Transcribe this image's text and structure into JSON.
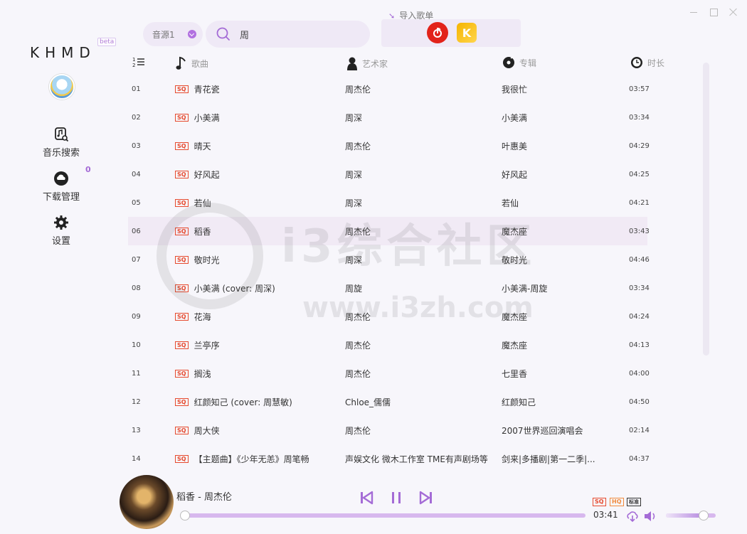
{
  "app": {
    "logo": "KHMD",
    "beta_tag": "beta"
  },
  "sidebar": {
    "items": [
      {
        "label": "音乐搜索",
        "icon": "music-search-icon"
      },
      {
        "label": "下载管理",
        "icon": "cloud-download-icon",
        "badge": "0"
      },
      {
        "label": "设置",
        "icon": "gear-icon"
      }
    ]
  },
  "topbar": {
    "source": "音源1",
    "search_value": "周",
    "import_label": "导入歌单"
  },
  "table": {
    "headers": {
      "title": "歌曲",
      "artist": "艺术家",
      "album": "专辑",
      "duration": "时长"
    },
    "rows": [
      {
        "num": "01",
        "title": "青花瓷",
        "artist": "周杰伦",
        "album": "我很忙",
        "duration": "03:57"
      },
      {
        "num": "02",
        "title": "小美满",
        "artist": "周深",
        "album": "小美满",
        "duration": "03:34"
      },
      {
        "num": "03",
        "title": "晴天",
        "artist": "周杰伦",
        "album": "叶惠美",
        "duration": "04:29"
      },
      {
        "num": "04",
        "title": "好风起",
        "artist": "周深",
        "album": "好风起",
        "duration": "04:25"
      },
      {
        "num": "05",
        "title": "若仙",
        "artist": "周深",
        "album": "若仙",
        "duration": "04:21"
      },
      {
        "num": "06",
        "title": "稻香",
        "artist": "周杰伦",
        "album": "魔杰座",
        "duration": "03:43"
      },
      {
        "num": "07",
        "title": "敬时光",
        "artist": "周深",
        "album": "敬时光",
        "duration": "04:46"
      },
      {
        "num": "08",
        "title": "小美满 (cover: 周深)",
        "artist": "周旋",
        "album": "小美满-周旋",
        "duration": "03:34"
      },
      {
        "num": "09",
        "title": "花海",
        "artist": "周杰伦",
        "album": "魔杰座",
        "duration": "04:24"
      },
      {
        "num": "10",
        "title": "兰亭序",
        "artist": "周杰伦",
        "album": "魔杰座",
        "duration": "04:13"
      },
      {
        "num": "11",
        "title": "搁浅",
        "artist": "周杰伦",
        "album": "七里香",
        "duration": "04:00"
      },
      {
        "num": "12",
        "title": "红颜知己 (cover: 周慧敏)",
        "artist": "Chloe_儒儒",
        "album": "红颜知己",
        "duration": "04:50"
      },
      {
        "num": "13",
        "title": "周大侠",
        "artist": "周杰伦",
        "album": "2007世界巡回演唱会",
        "duration": "02:14"
      },
      {
        "num": "14",
        "title": "【主题曲】《少年无恙》周笔畅",
        "artist": "声娱文化 微木工作室 TME有声剧场等",
        "album": "剑来|多播剧|第一二季|...",
        "duration": "04:37"
      }
    ],
    "quality_tag": "SQ",
    "active_row": 5
  },
  "watermark": {
    "text": "i3综合社区",
    "url": "www.i3zh.com"
  },
  "player": {
    "now_playing": "稻香 - 周杰伦",
    "current_time": "03:41",
    "progress": 0.0,
    "volume": 0.75,
    "quality_sq": "SQ",
    "quality_hq": "HQ",
    "quality_std": "标准"
  },
  "colors": {
    "accent": "#a46bd6",
    "sq": "#e64a2e",
    "netease": "#e2231a"
  }
}
